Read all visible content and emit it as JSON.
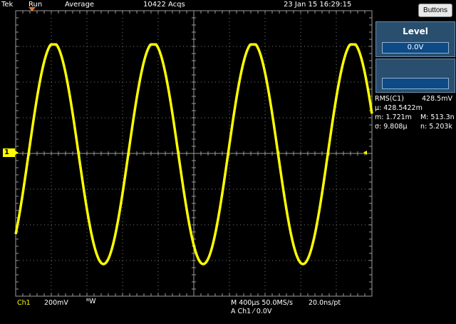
{
  "status": {
    "brand": "Tek",
    "acquisition_state": "Run",
    "acquisition_mode": "Average",
    "acquisitions": "10422 Acqs",
    "datetime": "23 Jan 15 16:29:15"
  },
  "buttons_label": "Buttons",
  "level_panel": {
    "title": "Level",
    "value": "0.0V"
  },
  "measurements": {
    "rms_label": "RMS(C1)",
    "rms_value": "428.5mV",
    "mean": "μ: 428.5422m",
    "min": "m: 1.721m",
    "max": "M: 513.3n",
    "sigma": "σ: 9.808μ",
    "count": "n: 5.203k"
  },
  "channel_marker": "1",
  "bottom": {
    "channel": "Ch1",
    "volts_per_div": "200mV",
    "bw": "ᴮW",
    "timebase": "M 400μs 50.0MS/s",
    "time_per_point": "20.0ns/pt",
    "trigger": "A  Ch1  ⁄  0.0V"
  },
  "colors": {
    "trace": "#ffff00",
    "panel": "#2a4e6e",
    "grid": "#7a7a7a"
  },
  "waveform": {
    "shape": "sine",
    "amplitude_divisions": 3.1,
    "period_ms": 1.12,
    "clipped_top": true
  }
}
